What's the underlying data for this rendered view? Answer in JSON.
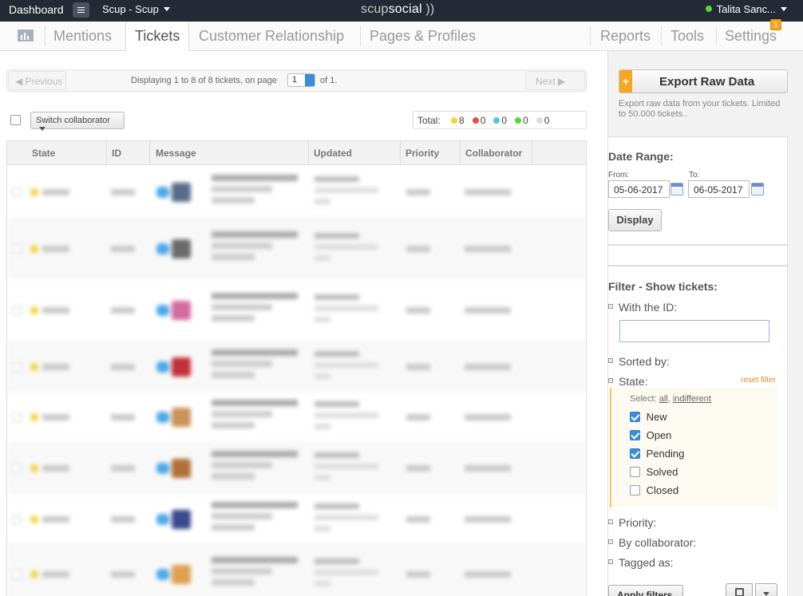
{
  "topbar": {
    "dashboard": "Dashboard",
    "account": "Scup - Scup",
    "logo_a": "scup",
    "logo_b": "social",
    "logo_c": " ))",
    "user": "Talita Sanc..."
  },
  "nav": {
    "tabs": [
      "Mentions",
      "Tickets",
      "Customer Relationship",
      "Pages & Profiles",
      "Reports",
      "Tools",
      "Settings"
    ],
    "active": "Tickets",
    "badge": "1"
  },
  "pager": {
    "prev": "◀ Previous",
    "next": "Next    ▶",
    "info": "Displaying 1 to 8 of 8 tickets, on page",
    "page": "1",
    "of": "of 1."
  },
  "toolbar": {
    "switch_collaborator": "Switch collaborator",
    "totals_label": "Total:",
    "totals": [
      {
        "color": "#f3d23a",
        "count": "8"
      },
      {
        "color": "#e84c3d",
        "count": "0"
      },
      {
        "color": "#4fc3f0",
        "count": "0"
      },
      {
        "color": "#5bd33b",
        "count": "0"
      },
      {
        "color": "#dddddd",
        "count": "0"
      }
    ]
  },
  "table": {
    "headers": [
      "State",
      "ID",
      "Message",
      "Updated",
      "Priority",
      "Collaborator"
    ],
    "row_count": 8,
    "avatar_colors": [
      "#5a6b8c",
      "#6b6b6b",
      "#d46aa0",
      "#c2303a",
      "#c9935a",
      "#b0703a",
      "#3a4a8c",
      "#e0a050"
    ]
  },
  "export": {
    "label": "Export Raw Data",
    "plus": "+",
    "desc": "Export raw data from your tickets. Limited to 50.000 tickets.."
  },
  "date_range": {
    "title": "Date Range:",
    "from_label": "From:",
    "to_label": "To:",
    "from": "05-06-2017",
    "to": "06-05-2017",
    "display": "Display"
  },
  "filter": {
    "title": "Filter - Show tickets:",
    "with_id": "With the ID:",
    "sorted_by": "Sorted by:",
    "state": "State:",
    "reset": "reset filter",
    "select_prefix": "Select:",
    "select_all": "all",
    "select_indiff": "indifferent",
    "states": [
      {
        "label": "New",
        "checked": true
      },
      {
        "label": "Open",
        "checked": true
      },
      {
        "label": "Pending",
        "checked": true
      },
      {
        "label": "Solved",
        "checked": false
      },
      {
        "label": "Closed",
        "checked": false
      }
    ],
    "priority": "Priority:",
    "by_collaborator": "By collaborator:",
    "tagged_as": "Tagged as:",
    "apply": "Apply filters"
  }
}
